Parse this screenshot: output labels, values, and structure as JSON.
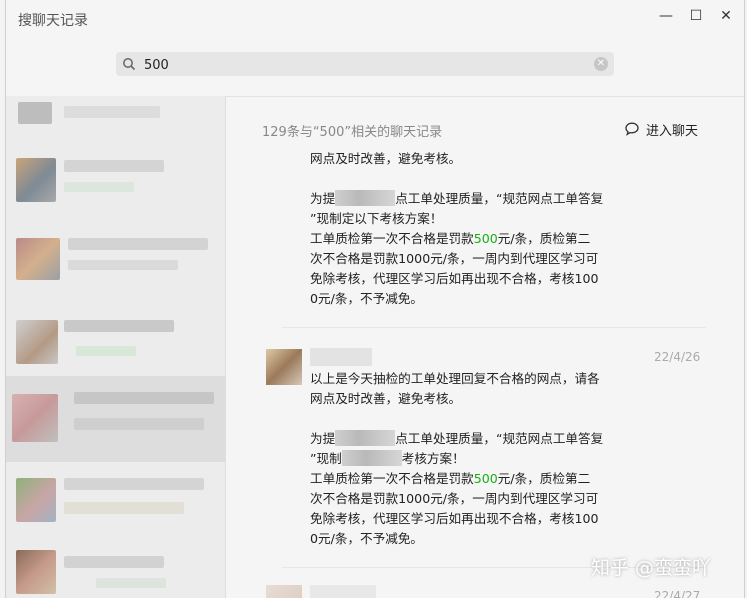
{
  "window": {
    "title": "搜聊天记录",
    "minimize": "—",
    "maximize": "☐",
    "close": "✕"
  },
  "search": {
    "value": "500",
    "clear": "✕"
  },
  "results": {
    "summary": "129条与“500”相关的聊天记录",
    "enter_chat": "进入聊天"
  },
  "messages": [
    {
      "date": "",
      "lines": [
        "网点及时改善，避免考核。",
        "",
        "为提█████点工单处理质量，“规范网点工单答复",
        "”现制定以下考核方案！",
        "工单质检第一次不合格是罚款{500}元/条，质检第二",
        "次不合格是罚款1000元/条，一周内到代理区学习可",
        "免除考核，代理区学习后如再出现不合格，考核100",
        "0元/条，不予减免。"
      ]
    },
    {
      "date": "22/4/26",
      "lines": [
        "以上是今天抽检的工单处理回复不合格的网点，请各",
        "网点及时改善，避免考核。",
        "",
        "为提█████点工单处理质量，“规范网点工单答复",
        "”现制█████考核方案！",
        "工单质检第一次不合格是罚款{500}元/条，质检第二",
        "次不合格是罚款1000元/条，一周内到代理区学习可",
        "免除考核，代理区学习后如再出现不合格，考核100",
        "0元/条，不予减免。"
      ]
    },
    {
      "date": "22/4/27",
      "lines": []
    }
  ],
  "watermark": "知乎 @蛮蛮吖",
  "colors": {
    "highlight": "#1aad19",
    "window_bg": "#f5f5f5",
    "sidebar_bg": "#ececec"
  }
}
